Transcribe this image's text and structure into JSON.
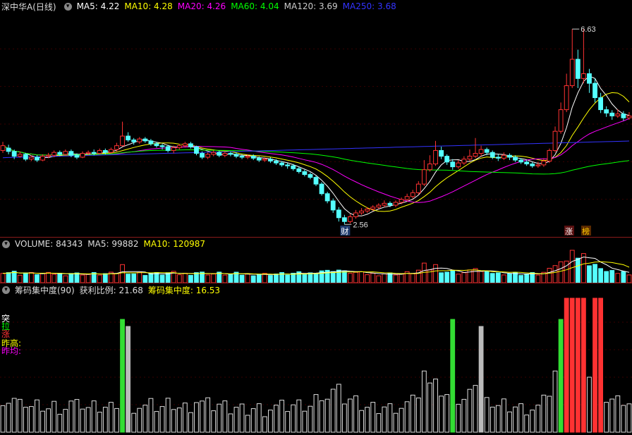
{
  "main": {
    "stock_name": "深中华A(日线)",
    "ma": [
      {
        "label": "MA5: 4.22",
        "color": "#ffffff"
      },
      {
        "label": "MA10: 4.28",
        "color": "#ffff00"
      },
      {
        "label": "MA20: 4.26",
        "color": "#ff00ff"
      },
      {
        "label": "MA60: 4.04",
        "color": "#00ff00"
      },
      {
        "label": "MA120: 3.69",
        "color": "#cccccc"
      },
      {
        "label": "MA250: 3.68",
        "color": "#3333ff"
      }
    ],
    "high_marker": "6.63",
    "low_marker": "2.56",
    "badge_cai": "财",
    "badge_zhang": "涨",
    "badge_bang": "榜"
  },
  "volume": {
    "title": "VOLUME: 84343",
    "ma5": "MA5: 99882",
    "ma10": "MA10: 120987"
  },
  "chip": {
    "title": "筹码集中度(90)",
    "profit": "获利比例: 21.68",
    "conc": "筹码集中度: 16.53",
    "legend": [
      {
        "text": "突",
        "color": "#ffffff"
      },
      {
        "text": "拉",
        "color": "#00ff00"
      },
      {
        "text": "涨",
        "color": "#ff3333"
      },
      {
        "text": "昨高:",
        "color": "#ffff00"
      },
      {
        "text": "昨均:",
        "color": "#ff00ff"
      }
    ]
  },
  "chart_data": {
    "type": "candlestick",
    "price_range": [
      2.3,
      7.0
    ],
    "candles": [
      [
        4.1,
        4.2,
        4.28,
        4.05
      ],
      [
        4.15,
        4.08,
        4.22,
        4.02
      ],
      [
        4.08,
        3.98,
        4.12,
        3.92
      ],
      [
        3.98,
        4.02,
        4.08,
        3.95
      ],
      [
        4.02,
        3.92,
        4.05,
        3.88
      ],
      [
        3.92,
        3.96,
        4.0,
        3.88
      ],
      [
        3.96,
        3.9,
        4.0,
        3.86
      ],
      [
        3.9,
        3.98,
        4.02,
        3.88
      ],
      [
        3.98,
        4.0,
        4.05,
        3.94
      ],
      [
        4.0,
        4.06,
        4.1,
        3.96
      ],
      [
        4.06,
        4.02,
        4.1,
        3.98
      ],
      [
        4.02,
        4.08,
        4.12,
        4.0
      ],
      [
        4.08,
        4.0,
        4.12,
        3.96
      ],
      [
        4.0,
        3.96,
        4.04,
        3.92
      ],
      [
        3.96,
        4.04,
        4.08,
        3.94
      ],
      [
        4.04,
        4.06,
        4.1,
        4.0
      ],
      [
        4.06,
        4.04,
        4.12,
        4.0
      ],
      [
        4.04,
        4.1,
        4.14,
        4.02
      ],
      [
        4.1,
        4.06,
        4.14,
        4.02
      ],
      [
        4.06,
        4.12,
        4.16,
        4.04
      ],
      [
        4.12,
        4.2,
        4.26,
        4.08
      ],
      [
        4.2,
        4.4,
        4.7,
        4.18
      ],
      [
        4.4,
        4.32,
        4.48,
        4.28
      ],
      [
        4.32,
        4.28,
        4.36,
        4.22
      ],
      [
        4.28,
        4.34,
        4.38,
        4.24
      ],
      [
        4.34,
        4.3,
        4.38,
        4.26
      ],
      [
        4.3,
        4.24,
        4.34,
        4.2
      ],
      [
        4.24,
        4.2,
        4.28,
        4.16
      ],
      [
        4.2,
        4.18,
        4.24,
        4.12
      ],
      [
        4.18,
        4.1,
        4.22,
        4.06
      ],
      [
        4.1,
        4.16,
        4.2,
        4.04
      ],
      [
        4.16,
        4.2,
        4.24,
        4.12
      ],
      [
        4.2,
        4.24,
        4.28,
        4.16
      ],
      [
        4.24,
        4.18,
        4.28,
        4.14
      ],
      [
        4.18,
        4.04,
        4.2,
        4.0
      ],
      [
        4.04,
        3.96,
        4.08,
        3.92
      ],
      [
        3.96,
        4.02,
        4.06,
        3.92
      ],
      [
        4.02,
        4.06,
        4.1,
        3.98
      ],
      [
        4.06,
        4.0,
        4.1,
        3.96
      ],
      [
        4.0,
        4.04,
        4.08,
        3.96
      ],
      [
        4.04,
        4.02,
        4.08,
        3.98
      ],
      [
        4.02,
        3.98,
        4.06,
        3.94
      ],
      [
        3.98,
        3.96,
        4.02,
        3.92
      ],
      [
        3.96,
        3.98,
        4.02,
        3.92
      ],
      [
        3.98,
        3.94,
        4.02,
        3.9
      ],
      [
        3.94,
        3.9,
        3.98,
        3.86
      ],
      [
        3.9,
        3.92,
        3.96,
        3.86
      ],
      [
        3.92,
        3.88,
        3.96,
        3.84
      ],
      [
        3.88,
        3.84,
        3.92,
        3.8
      ],
      [
        3.84,
        3.8,
        3.88,
        3.76
      ],
      [
        3.8,
        3.78,
        3.84,
        3.72
      ],
      [
        3.78,
        3.72,
        3.82,
        3.68
      ],
      [
        3.72,
        3.66,
        3.76,
        3.62
      ],
      [
        3.66,
        3.6,
        3.7,
        3.56
      ],
      [
        3.6,
        3.54,
        3.64,
        3.5
      ],
      [
        3.54,
        3.4,
        3.58,
        3.36
      ],
      [
        3.4,
        3.2,
        3.44,
        3.16
      ],
      [
        3.2,
        3.05,
        3.24,
        3.0
      ],
      [
        3.05,
        2.86,
        3.1,
        2.8
      ],
      [
        2.86,
        2.7,
        2.92,
        2.62
      ],
      [
        2.7,
        2.62,
        2.76,
        2.56
      ],
      [
        2.62,
        2.72,
        2.78,
        2.58
      ],
      [
        2.72,
        2.8,
        2.86,
        2.68
      ],
      [
        2.8,
        2.84,
        2.9,
        2.76
      ],
      [
        2.84,
        2.88,
        2.92,
        2.8
      ],
      [
        2.88,
        2.92,
        2.96,
        2.84
      ],
      [
        2.92,
        2.96,
        3.0,
        2.88
      ],
      [
        2.96,
        3.0,
        3.06,
        2.92
      ],
      [
        3.0,
        2.96,
        3.04,
        2.92
      ],
      [
        2.96,
        3.02,
        3.06,
        2.92
      ],
      [
        3.02,
        3.08,
        3.12,
        2.98
      ],
      [
        3.08,
        3.14,
        3.2,
        3.04
      ],
      [
        3.14,
        3.22,
        3.28,
        3.1
      ],
      [
        3.22,
        3.4,
        3.46,
        3.18
      ],
      [
        3.4,
        3.7,
        3.9,
        3.36
      ],
      [
        3.7,
        3.82,
        4.0,
        3.66
      ],
      [
        3.82,
        4.1,
        4.3,
        3.78
      ],
      [
        4.1,
        3.98,
        4.18,
        3.92
      ],
      [
        3.98,
        3.86,
        4.02,
        3.8
      ],
      [
        3.86,
        3.76,
        3.92,
        3.7
      ],
      [
        3.76,
        3.84,
        3.9,
        3.72
      ],
      [
        3.84,
        3.92,
        3.98,
        3.8
      ],
      [
        3.92,
        3.98,
        4.12,
        3.88
      ],
      [
        3.98,
        4.04,
        4.36,
        3.94
      ],
      [
        4.04,
        4.12,
        4.2,
        3.98
      ],
      [
        4.12,
        4.06,
        4.16,
        4.0
      ],
      [
        4.06,
        3.96,
        4.1,
        3.92
      ],
      [
        3.96,
        3.94,
        4.02,
        3.88
      ],
      [
        3.94,
        4.0,
        4.06,
        3.9
      ],
      [
        4.0,
        3.96,
        4.04,
        3.9
      ],
      [
        3.96,
        3.9,
        4.0,
        3.86
      ],
      [
        3.9,
        3.86,
        3.94,
        3.82
      ],
      [
        3.86,
        3.82,
        3.9,
        3.78
      ],
      [
        3.82,
        3.78,
        3.86,
        3.74
      ],
      [
        3.78,
        3.8,
        3.86,
        3.74
      ],
      [
        3.8,
        3.88,
        3.94,
        3.76
      ],
      [
        3.88,
        4.1,
        4.14,
        3.84
      ],
      [
        4.1,
        4.5,
        4.6,
        4.06
      ],
      [
        4.5,
        4.95,
        5.1,
        4.45
      ],
      [
        4.95,
        5.45,
        5.7,
        4.9
      ],
      [
        5.45,
        6.0,
        6.63,
        5.4
      ],
      [
        6.0,
        5.6,
        6.2,
        5.4
      ],
      [
        5.6,
        5.7,
        6.63,
        5.5
      ],
      [
        5.7,
        5.5,
        5.8,
        5.3
      ],
      [
        5.5,
        5.2,
        5.6,
        5.1
      ],
      [
        5.2,
        4.95,
        5.3,
        4.88
      ],
      [
        4.95,
        4.88,
        5.02,
        4.8
      ],
      [
        4.88,
        4.82,
        4.94,
        4.74
      ],
      [
        4.82,
        4.86,
        4.96,
        4.78
      ],
      [
        4.86,
        4.78,
        4.92,
        4.72
      ],
      [
        4.78,
        4.82,
        4.9,
        4.74
      ]
    ]
  }
}
